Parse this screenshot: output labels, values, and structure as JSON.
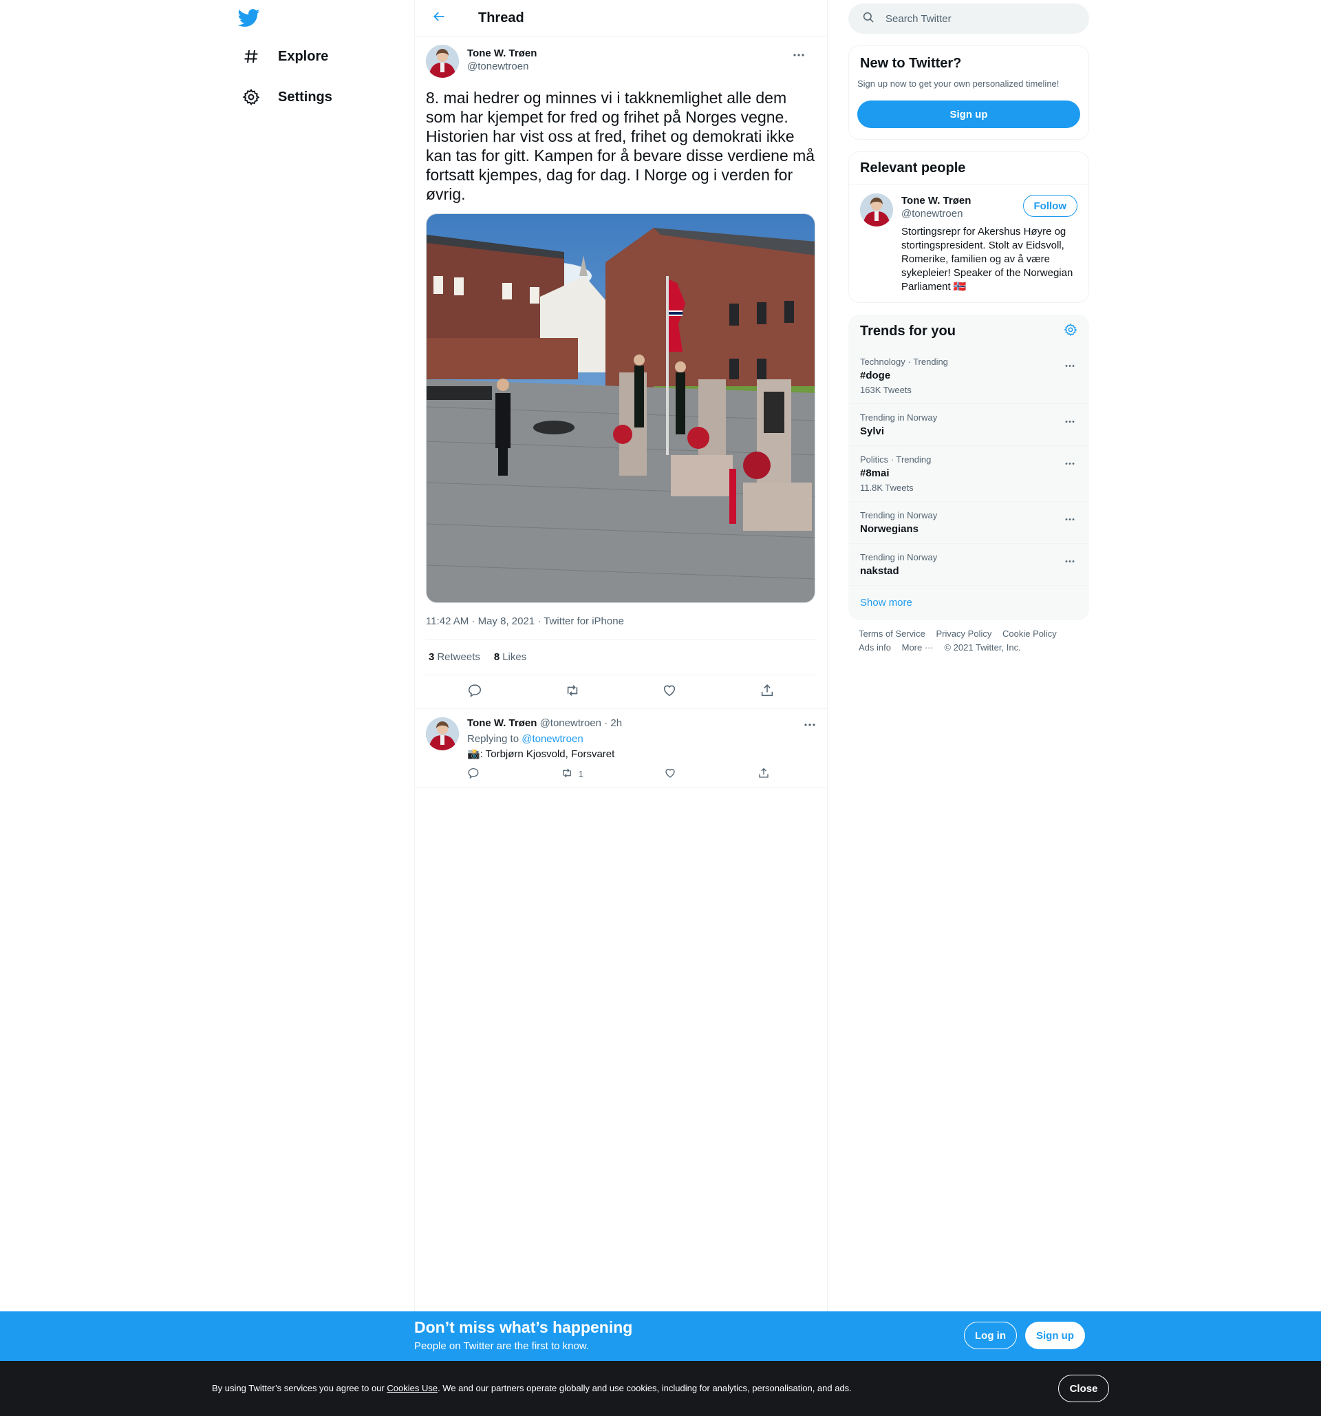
{
  "nav": {
    "explore": "Explore",
    "settings": "Settings"
  },
  "header": {
    "title": "Thread"
  },
  "tweet": {
    "author_name": "Tone W. Trøen",
    "author_handle": "@tonewtroen",
    "text": "8. mai hedrer og minnes vi i takknemlighet alle dem som har kjempet for fred og frihet på Norges vegne. Historien har vist oss at fred, frihet og demokrati ikke kan tas for gitt. Kampen for å bevare disse verdiene må fortsatt kjempes, dag for dag. I Norge og i verden for øvrig.",
    "meta": "11:42 AM · May 8, 2021 · Twitter for iPhone",
    "retweets_count": "3",
    "retweets_label": "Retweets",
    "likes_count": "8",
    "likes_label": "Likes"
  },
  "reply": {
    "author_name": "Tone W. Trøen",
    "author_handle": "@tonewtroen",
    "time": "· 2h",
    "replying_to_label": "Replying to",
    "replying_to_handle": "@tonewtroen",
    "text": "📸: Torbjørn Kjosvold, Forsvaret",
    "retweet_count": "1"
  },
  "search": {
    "placeholder": "Search Twitter"
  },
  "new_to_twitter": {
    "title": "New to Twitter?",
    "subtitle": "Sign up now to get your own personalized timeline!",
    "signup_label": "Sign up"
  },
  "relevant_people": {
    "title": "Relevant people",
    "name": "Tone W. Trøen",
    "handle": "@tonewtroen",
    "bio": "Stortingsrepr for Akershus Høyre og stortingspresident. Stolt av Eidsvoll, Romerike, familien og av å være sykepleier! Speaker of the Norwegian Parliament 🇳🇴",
    "follow_label": "Follow"
  },
  "trends": {
    "title": "Trends for you",
    "items": [
      {
        "context": "Technology · Trending",
        "name": "#doge",
        "count": "163K Tweets"
      },
      {
        "context": "Trending in Norway",
        "name": "Sylvi",
        "count": ""
      },
      {
        "context": "Politics · Trending",
        "name": "#8mai",
        "count": "11.8K Tweets"
      },
      {
        "context": "Trending in Norway",
        "name": "Norwegians",
        "count": ""
      },
      {
        "context": "Trending in Norway",
        "name": "nakstad",
        "count": ""
      }
    ],
    "show_more": "Show more"
  },
  "footer": {
    "terms": "Terms of Service",
    "privacy": "Privacy Policy",
    "cookie": "Cookie Policy",
    "ads": "Ads info",
    "more": "More ···",
    "copyright": "© 2021 Twitter, Inc."
  },
  "banner": {
    "title": "Don’t miss what’s happening",
    "subtitle": "People on Twitter are the first to know.",
    "login_label": "Log in",
    "signup_label": "Sign up"
  },
  "cookie_bar": {
    "prefix": "By using Twitter’s services you agree to our",
    "link": "Cookies Use",
    "suffix": ". We and our partners operate globally and use cookies, including for analytics, personalisation, and ads.",
    "close_label": "Close"
  },
  "colors": {
    "accent": "#1d9bf0",
    "text": "#0f1419",
    "secondary": "#536471",
    "cookie_bg": "#16181c"
  }
}
